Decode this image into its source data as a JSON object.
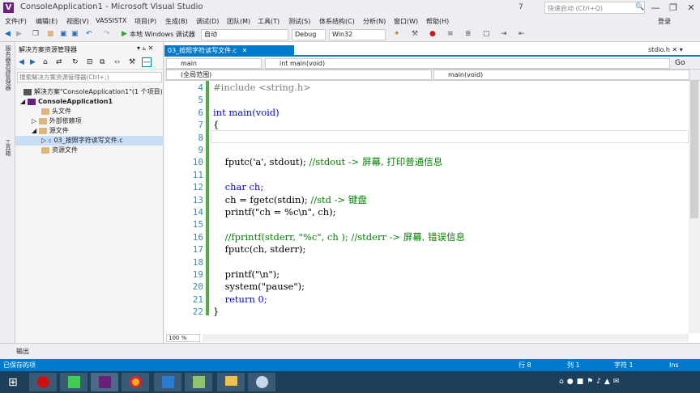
{
  "window": {
    "title": "ConsoleApplication1 - Microsoft Visual Studio",
    "quick_launch_placeholder": "快速启动 (Ctrl+Q)",
    "notifications": "7",
    "signin": "登录",
    "min": "—",
    "max": "❐",
    "close": "✕"
  },
  "menu": [
    "文件(F)",
    "编辑(E)",
    "视图(V)",
    "VASSISTX",
    "项目(P)",
    "生成(B)",
    "调试(D)",
    "团队(M)",
    "工具(T)",
    "测试(S)",
    "体系结构(C)",
    "分析(N)",
    "窗口(W)",
    "帮助(H)"
  ],
  "toolbar": {
    "debugger_label": "本地 Windows 调试器",
    "run_mode": "自动",
    "config": "Debug",
    "platform": "Win32"
  },
  "side_tabs": [
    "服务器资源管理器",
    "工具箱"
  ],
  "solution_explorer": {
    "title": "解决方案资源管理器",
    "search_placeholder": "搜索解决方案资源管理器(Ctrl+;)",
    "items": [
      {
        "label": "解决方案\"ConsoleApplication1\"(1 个项目)"
      },
      {
        "label": "ConsoleApplication1"
      },
      {
        "label": "头文件"
      },
      {
        "label": "外部依赖项"
      },
      {
        "label": "源文件"
      },
      {
        "label": "03_按照字符读写文件.c"
      },
      {
        "label": "资源文件"
      }
    ]
  },
  "editor": {
    "tab": "03_按照字符读写文件.c",
    "tab_right": "stdio.h",
    "nav_scope": "main",
    "nav_member": "int main(void)",
    "nav_global": "(全局范围)",
    "nav_func": "main(void)",
    "go_label": "Go",
    "zoom": "100 %",
    "lines": [
      {
        "num": "4",
        "text": "#include <string.h>"
      },
      {
        "num": "5",
        "text": ""
      },
      {
        "num": "6",
        "text": "int main(void)"
      },
      {
        "num": "7",
        "text": "{"
      },
      {
        "num": "8",
        "text": ""
      },
      {
        "num": "9",
        "text": ""
      },
      {
        "num": "10",
        "text": "    fputc('a', stdout); //stdout -> 屏幕, 打印普通信息"
      },
      {
        "num": "11",
        "text": ""
      },
      {
        "num": "12",
        "text": "    char ch;"
      },
      {
        "num": "13",
        "text": "    ch = fgetc(stdin); //std -> 键盘"
      },
      {
        "num": "14",
        "text": "    printf(\"ch = %c\\n\", ch);"
      },
      {
        "num": "15",
        "text": ""
      },
      {
        "num": "16",
        "text": "    //fprintf(stderr, \"%c\", ch ); //stderr -> 屏幕, 错误信息"
      },
      {
        "num": "17",
        "text": "    fputc(ch, stderr);"
      },
      {
        "num": "18",
        "text": ""
      },
      {
        "num": "19",
        "text": "    printf(\"\\n\");"
      },
      {
        "num": "20",
        "text": "    system(\"pause\");"
      },
      {
        "num": "21",
        "text": "    return 0;"
      },
      {
        "num": "22",
        "text": "}"
      }
    ]
  },
  "output_tab": "输出",
  "status": {
    "message": "已保存的项",
    "row": "行 8",
    "col": "列 1",
    "char": "字符 1",
    "mode": "Ins"
  },
  "taskbar": {
    "apps": [
      "recorder",
      "qt-creator",
      "visual-studio",
      "chrome",
      "wps-writer",
      "notepad-plus",
      "file-explorer",
      "paint"
    ]
  }
}
